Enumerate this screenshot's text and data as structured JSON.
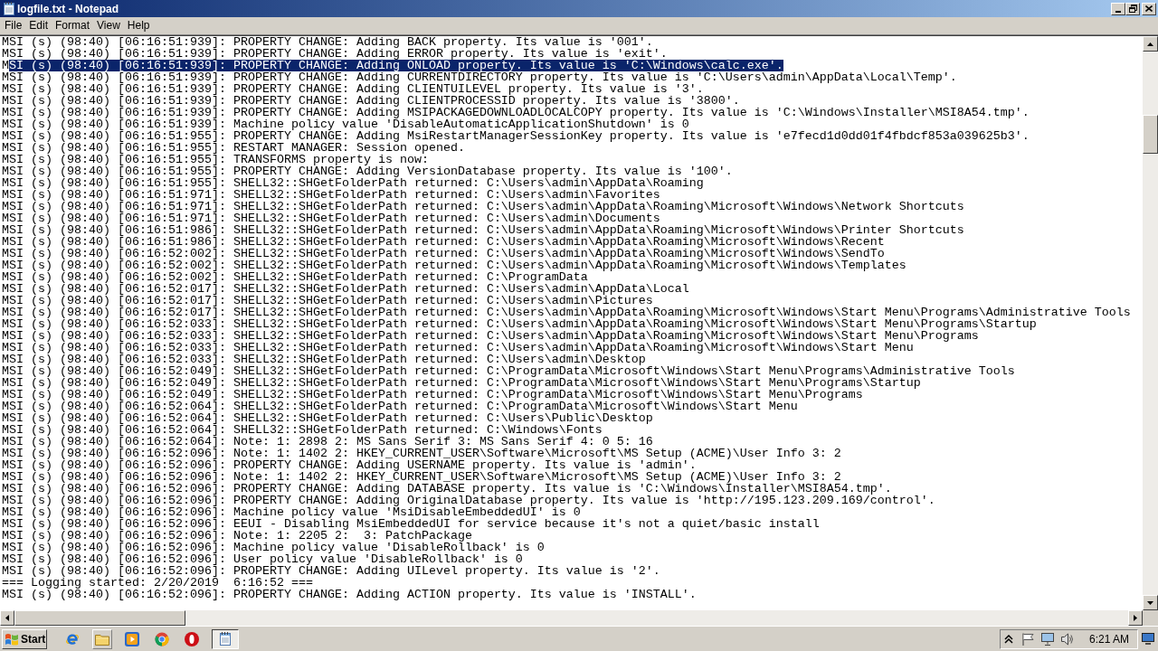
{
  "window": {
    "title": "logfile.txt - Notepad"
  },
  "menu": [
    "File",
    "Edit",
    "Format",
    "View",
    "Help"
  ],
  "editor": {
    "lines": [
      {
        "segments": [
          {
            "text": "MSI (s) (98:40) [06:16:51:939]: PROPERTY CHANGE: Adding BACK property. Its value is '001'.",
            "selected": false
          }
        ]
      },
      {
        "segments": [
          {
            "text": "MSI (s) (98:40) [06:16:51:939]: PROPERTY CHANGE: Adding ERROR property. Its value is 'exit'.",
            "selected": false
          }
        ]
      },
      {
        "segments": [
          {
            "text": "M",
            "selected": false
          },
          {
            "text": "SI (s) (98:40) [06:16:51:939]: PROPERTY CHANGE: Adding ONLOAD property. Its value is 'C:\\Windows\\calc.exe'.",
            "selected": true
          }
        ]
      },
      {
        "segments": [
          {
            "text": "MSI (s) (98:40) [06:16:51:939]: PROPERTY CHANGE: Adding CURRENTDIRECTORY property. Its value is 'C:\\Users\\admin\\AppData\\Local\\Temp'.",
            "selected": false
          }
        ]
      },
      {
        "segments": [
          {
            "text": "MSI (s) (98:40) [06:16:51:939]: PROPERTY CHANGE: Adding CLIENTUILEVEL property. Its value is '3'.",
            "selected": false
          }
        ]
      },
      {
        "segments": [
          {
            "text": "MSI (s) (98:40) [06:16:51:939]: PROPERTY CHANGE: Adding CLIENTPROCESSID property. Its value is '3800'.",
            "selected": false
          }
        ]
      },
      {
        "segments": [
          {
            "text": "MSI (s) (98:40) [06:16:51:939]: PROPERTY CHANGE: Adding MSIPACKAGEDOWNLOADLOCALCOPY property. Its value is 'C:\\Windows\\Installer\\MSI8A54.tmp'.",
            "selected": false
          }
        ]
      },
      {
        "segments": [
          {
            "text": "MSI (s) (98:40) [06:16:51:939]: Machine policy value 'DisableAutomaticApplicationShutdown' is 0",
            "selected": false
          }
        ]
      },
      {
        "segments": [
          {
            "text": "MSI (s) (98:40) [06:16:51:955]: PROPERTY CHANGE: Adding MsiRestartManagerSessionKey property. Its value is 'e7fecd1d0dd01f4fbdcf853a039625b3'.",
            "selected": false
          }
        ]
      },
      {
        "segments": [
          {
            "text": "MSI (s) (98:40) [06:16:51:955]: RESTART MANAGER: Session opened.",
            "selected": false
          }
        ]
      },
      {
        "segments": [
          {
            "text": "MSI (s) (98:40) [06:16:51:955]: TRANSFORMS property is now:",
            "selected": false
          }
        ]
      },
      {
        "segments": [
          {
            "text": "MSI (s) (98:40) [06:16:51:955]: PROPERTY CHANGE: Adding VersionDatabase property. Its value is '100'.",
            "selected": false
          }
        ]
      },
      {
        "segments": [
          {
            "text": "MSI (s) (98:40) [06:16:51:955]: SHELL32::SHGetFolderPath returned: C:\\Users\\admin\\AppData\\Roaming",
            "selected": false
          }
        ]
      },
      {
        "segments": [
          {
            "text": "MSI (s) (98:40) [06:16:51:971]: SHELL32::SHGetFolderPath returned: C:\\Users\\admin\\Favorites",
            "selected": false
          }
        ]
      },
      {
        "segments": [
          {
            "text": "MSI (s) (98:40) [06:16:51:971]: SHELL32::SHGetFolderPath returned: C:\\Users\\admin\\AppData\\Roaming\\Microsoft\\Windows\\Network Shortcuts",
            "selected": false
          }
        ]
      },
      {
        "segments": [
          {
            "text": "MSI (s) (98:40) [06:16:51:971]: SHELL32::SHGetFolderPath returned: C:\\Users\\admin\\Documents",
            "selected": false
          }
        ]
      },
      {
        "segments": [
          {
            "text": "MSI (s) (98:40) [06:16:51:986]: SHELL32::SHGetFolderPath returned: C:\\Users\\admin\\AppData\\Roaming\\Microsoft\\Windows\\Printer Shortcuts",
            "selected": false
          }
        ]
      },
      {
        "segments": [
          {
            "text": "MSI (s) (98:40) [06:16:51:986]: SHELL32::SHGetFolderPath returned: C:\\Users\\admin\\AppData\\Roaming\\Microsoft\\Windows\\Recent",
            "selected": false
          }
        ]
      },
      {
        "segments": [
          {
            "text": "MSI (s) (98:40) [06:16:52:002]: SHELL32::SHGetFolderPath returned: C:\\Users\\admin\\AppData\\Roaming\\Microsoft\\Windows\\SendTo",
            "selected": false
          }
        ]
      },
      {
        "segments": [
          {
            "text": "MSI (s) (98:40) [06:16:52:002]: SHELL32::SHGetFolderPath returned: C:\\Users\\admin\\AppData\\Roaming\\Microsoft\\Windows\\Templates",
            "selected": false
          }
        ]
      },
      {
        "segments": [
          {
            "text": "MSI (s) (98:40) [06:16:52:002]: SHELL32::SHGetFolderPath returned: C:\\ProgramData",
            "selected": false
          }
        ]
      },
      {
        "segments": [
          {
            "text": "MSI (s) (98:40) [06:16:52:017]: SHELL32::SHGetFolderPath returned: C:\\Users\\admin\\AppData\\Local",
            "selected": false
          }
        ]
      },
      {
        "segments": [
          {
            "text": "MSI (s) (98:40) [06:16:52:017]: SHELL32::SHGetFolderPath returned: C:\\Users\\admin\\Pictures",
            "selected": false
          }
        ]
      },
      {
        "segments": [
          {
            "text": "MSI (s) (98:40) [06:16:52:017]: SHELL32::SHGetFolderPath returned: C:\\Users\\admin\\AppData\\Roaming\\Microsoft\\Windows\\Start Menu\\Programs\\Administrative Tools",
            "selected": false
          }
        ]
      },
      {
        "segments": [
          {
            "text": "MSI (s) (98:40) [06:16:52:033]: SHELL32::SHGetFolderPath returned: C:\\Users\\admin\\AppData\\Roaming\\Microsoft\\Windows\\Start Menu\\Programs\\Startup",
            "selected": false
          }
        ]
      },
      {
        "segments": [
          {
            "text": "MSI (s) (98:40) [06:16:52:033]: SHELL32::SHGetFolderPath returned: C:\\Users\\admin\\AppData\\Roaming\\Microsoft\\Windows\\Start Menu\\Programs",
            "selected": false
          }
        ]
      },
      {
        "segments": [
          {
            "text": "MSI (s) (98:40) [06:16:52:033]: SHELL32::SHGetFolderPath returned: C:\\Users\\admin\\AppData\\Roaming\\Microsoft\\Windows\\Start Menu",
            "selected": false
          }
        ]
      },
      {
        "segments": [
          {
            "text": "MSI (s) (98:40) [06:16:52:033]: SHELL32::SHGetFolderPath returned: C:\\Users\\admin\\Desktop",
            "selected": false
          }
        ]
      },
      {
        "segments": [
          {
            "text": "MSI (s) (98:40) [06:16:52:049]: SHELL32::SHGetFolderPath returned: C:\\ProgramData\\Microsoft\\Windows\\Start Menu\\Programs\\Administrative Tools",
            "selected": false
          }
        ]
      },
      {
        "segments": [
          {
            "text": "MSI (s) (98:40) [06:16:52:049]: SHELL32::SHGetFolderPath returned: C:\\ProgramData\\Microsoft\\Windows\\Start Menu\\Programs\\Startup",
            "selected": false
          }
        ]
      },
      {
        "segments": [
          {
            "text": "MSI (s) (98:40) [06:16:52:049]: SHELL32::SHGetFolderPath returned: C:\\ProgramData\\Microsoft\\Windows\\Start Menu\\Programs",
            "selected": false
          }
        ]
      },
      {
        "segments": [
          {
            "text": "MSI (s) (98:40) [06:16:52:064]: SHELL32::SHGetFolderPath returned: C:\\ProgramData\\Microsoft\\Windows\\Start Menu",
            "selected": false
          }
        ]
      },
      {
        "segments": [
          {
            "text": "MSI (s) (98:40) [06:16:52:064]: SHELL32::SHGetFolderPath returned: C:\\Users\\Public\\Desktop",
            "selected": false
          }
        ]
      },
      {
        "segments": [
          {
            "text": "MSI (s) (98:40) [06:16:52:064]: SHELL32::SHGetFolderPath returned: C:\\Windows\\Fonts",
            "selected": false
          }
        ]
      },
      {
        "segments": [
          {
            "text": "MSI (s) (98:40) [06:16:52:064]: Note: 1: 2898 2: MS Sans Serif 3: MS Sans Serif 4: 0 5: 16",
            "selected": false
          }
        ]
      },
      {
        "segments": [
          {
            "text": "MSI (s) (98:40) [06:16:52:096]: Note: 1: 1402 2: HKEY_CURRENT_USER\\Software\\Microsoft\\MS Setup (ACME)\\User Info 3: 2",
            "selected": false
          }
        ]
      },
      {
        "segments": [
          {
            "text": "MSI (s) (98:40) [06:16:52:096]: PROPERTY CHANGE: Adding USERNAME property. Its value is 'admin'.",
            "selected": false
          }
        ]
      },
      {
        "segments": [
          {
            "text": "MSI (s) (98:40) [06:16:52:096]: Note: 1: 1402 2: HKEY_CURRENT_USER\\Software\\Microsoft\\MS Setup (ACME)\\User Info 3: 2",
            "selected": false
          }
        ]
      },
      {
        "segments": [
          {
            "text": "MSI (s) (98:40) [06:16:52:096]: PROPERTY CHANGE: Adding DATABASE property. Its value is 'C:\\Windows\\Installer\\MSI8A54.tmp'.",
            "selected": false
          }
        ]
      },
      {
        "segments": [
          {
            "text": "MSI (s) (98:40) [06:16:52:096]: PROPERTY CHANGE: Adding OriginalDatabase property. Its value is 'http://195.123.209.169/control'.",
            "selected": false
          }
        ]
      },
      {
        "segments": [
          {
            "text": "MSI (s) (98:40) [06:16:52:096]: Machine policy value 'MsiDisableEmbeddedUI' is 0",
            "selected": false
          }
        ]
      },
      {
        "segments": [
          {
            "text": "MSI (s) (98:40) [06:16:52:096]: EEUI - Disabling MsiEmbeddedUI for service because it's not a quiet/basic install",
            "selected": false
          }
        ]
      },
      {
        "segments": [
          {
            "text": "MSI (s) (98:40) [06:16:52:096]: Note: 1: 2205 2:  3: PatchPackage",
            "selected": false
          }
        ]
      },
      {
        "segments": [
          {
            "text": "MSI (s) (98:40) [06:16:52:096]: Machine policy value 'DisableRollback' is 0",
            "selected": false
          }
        ]
      },
      {
        "segments": [
          {
            "text": "MSI (s) (98:40) [06:16:52:096]: User policy value 'DisableRollback' is 0",
            "selected": false
          }
        ]
      },
      {
        "segments": [
          {
            "text": "MSI (s) (98:40) [06:16:52:096]: PROPERTY CHANGE: Adding UILevel property. Its value is '2'.",
            "selected": false
          }
        ]
      },
      {
        "segments": [
          {
            "text": "=== Logging started: 2/20/2019  6:16:52 ===",
            "selected": false
          }
        ]
      },
      {
        "segments": [
          {
            "text": "MSI (s) (98:40) [06:16:52:096]: PROPERTY CHANGE: Adding ACTION property. Its value is 'INSTALL'.",
            "selected": false
          }
        ]
      }
    ]
  },
  "taskbar": {
    "start": "Start",
    "window_button": {
      "active": true
    },
    "clock": "6:21 AM"
  }
}
